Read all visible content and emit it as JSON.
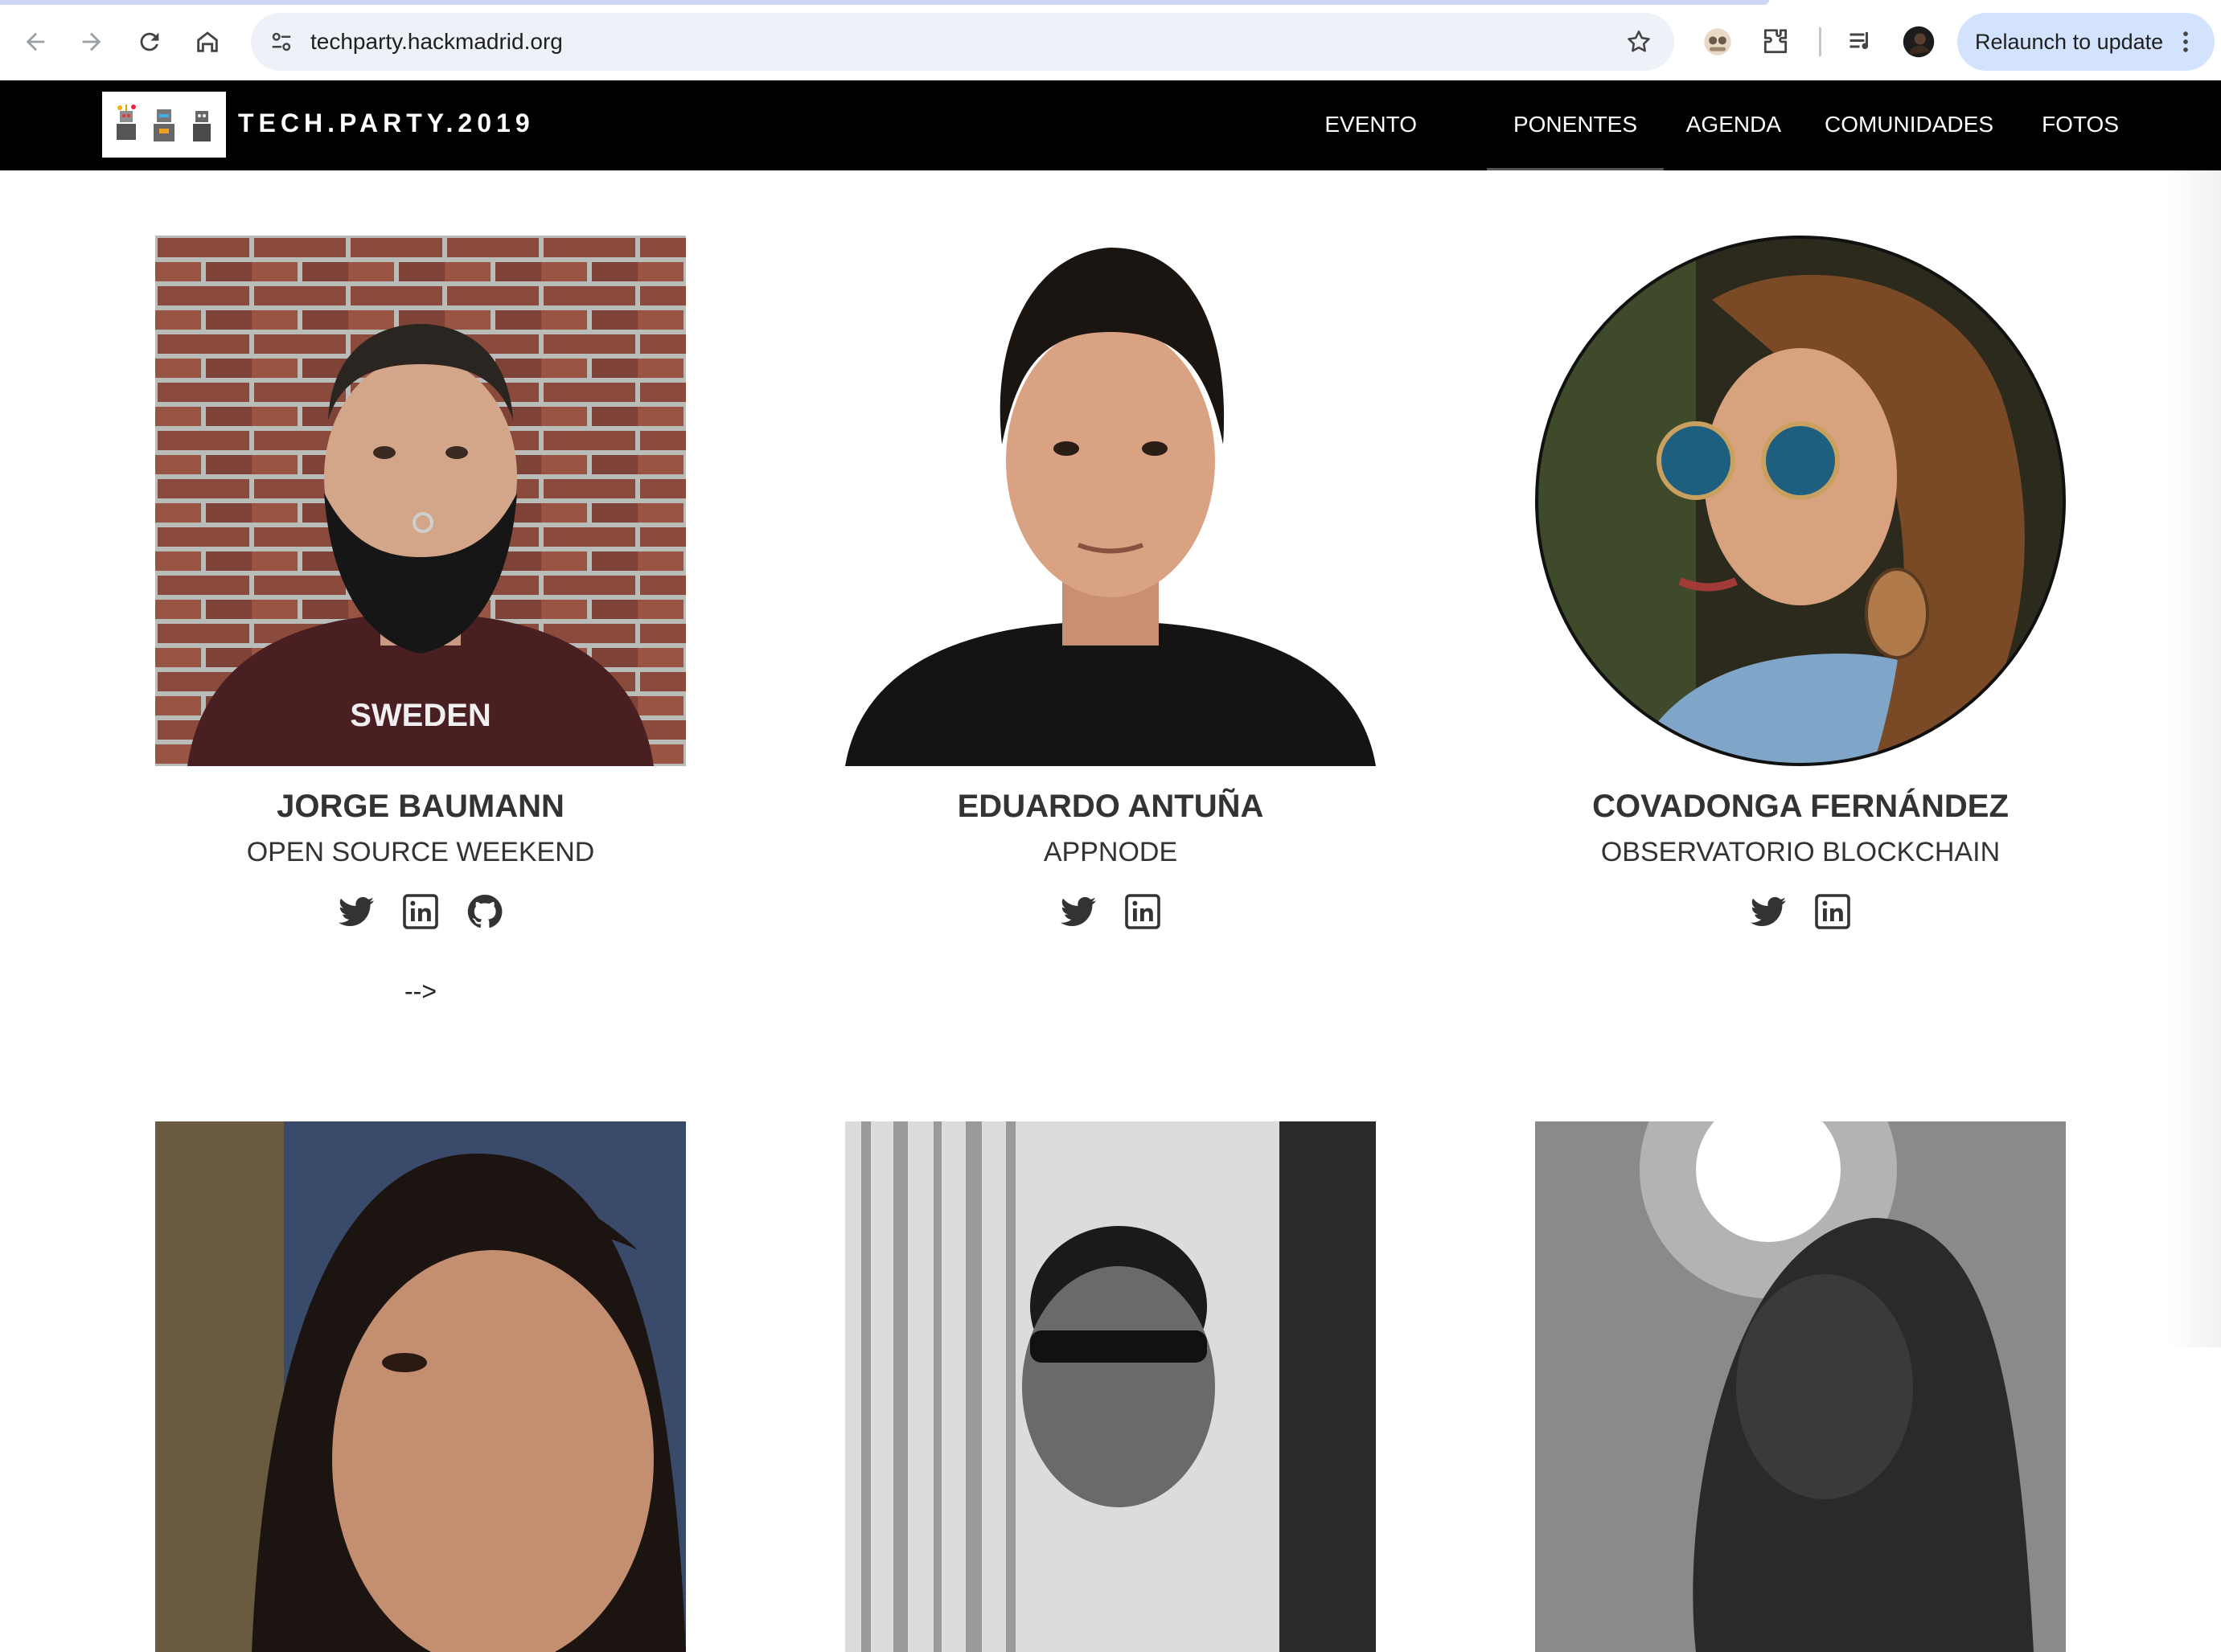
{
  "browser": {
    "url": "techparty.hackmadrid.org",
    "relaunch_label": "Relaunch to update"
  },
  "site": {
    "brand": "TECH.PARTY.2019",
    "nav": [
      "EVENTO",
      "PONENTES",
      "AGENDA",
      "COMUNIDADES",
      "FOTOS"
    ],
    "active_nav": "PONENTES"
  },
  "speakers": [
    {
      "name": "JORGE BAUMANN",
      "org": "OPEN SOURCE WEEKEND",
      "socials": [
        "twitter",
        "linkedin",
        "github"
      ]
    },
    {
      "name": "EDUARDO ANTUÑA",
      "org": "APPNODE",
      "socials": [
        "twitter",
        "linkedin"
      ]
    },
    {
      "name": "COVADONGA FERNÁNDEZ",
      "org": "OBSERVATORIO BLOCKCHAIN",
      "socials": [
        "twitter",
        "linkedin"
      ]
    }
  ],
  "stray_text": "-->",
  "colors": {
    "header_bg": "#000000",
    "text": "#333333",
    "relaunch_bg": "#d3e3fd"
  }
}
